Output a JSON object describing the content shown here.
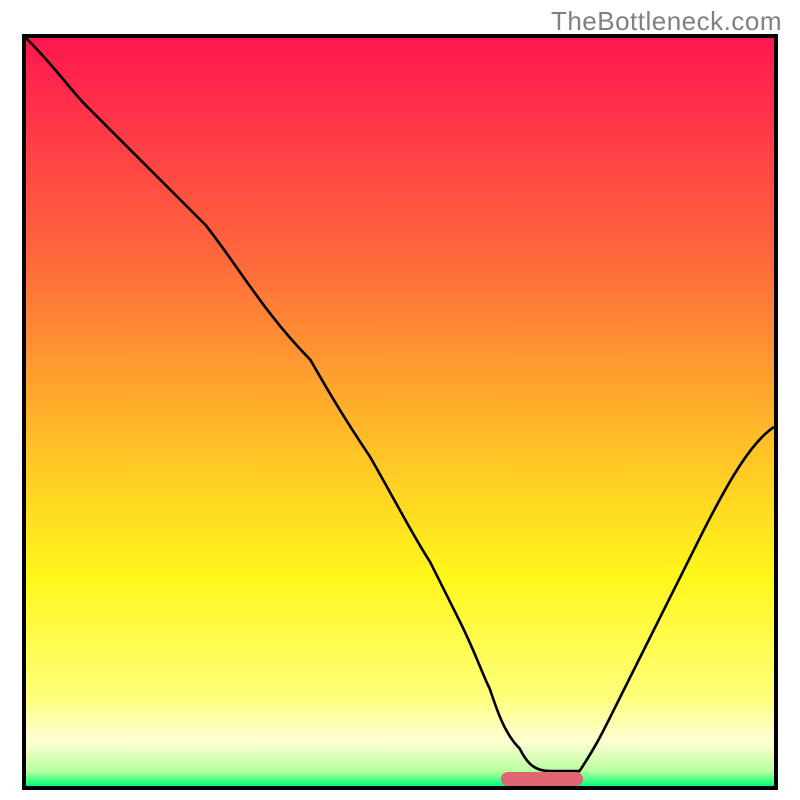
{
  "watermark": "TheBottleneck.com",
  "chart_data": {
    "type": "line",
    "title": "",
    "xlabel": "",
    "ylabel": "",
    "xlim": [
      0,
      100
    ],
    "ylim": [
      0,
      100
    ],
    "grid": false,
    "legend": false,
    "background": {
      "type": "vertical_gradient",
      "stops": [
        {
          "pos": 0,
          "color": "#ff1750"
        },
        {
          "pos": 30,
          "color": "#ff6a3b"
        },
        {
          "pos": 55,
          "color": "#ffc227"
        },
        {
          "pos": 72,
          "color": "#fff71a"
        },
        {
          "pos": 88,
          "color": "#ffff7a"
        },
        {
          "pos": 94,
          "color": "#ffffd5"
        },
        {
          "pos": 98,
          "color": "#b9ff9e"
        },
        {
          "pos": 100,
          "color": "#00ff7a"
        }
      ]
    },
    "series": [
      {
        "name": "bottleneck_curve",
        "color": "#000000",
        "x": [
          0,
          8,
          16,
          24,
          30,
          38,
          46,
          54,
          58,
          62,
          66,
          70,
          74,
          78,
          100
        ],
        "y": [
          100,
          91,
          83,
          75,
          68,
          57,
          44,
          30,
          22,
          13,
          5,
          2,
          2,
          7,
          48
        ]
      }
    ],
    "marker": {
      "shape": "rounded_rect",
      "color": "#e06673",
      "x_center": 69,
      "y": 0,
      "width": 10,
      "height": 2
    }
  }
}
